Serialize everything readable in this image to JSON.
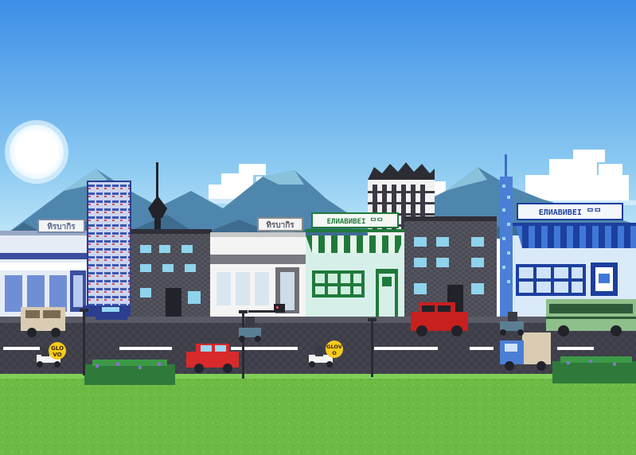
{
  "signs": {
    "sign_1": "ทิรบากิร",
    "sign_2": "ทิรบากิร",
    "sign_3": "ЕЛИАВИВЕІ ᄆᄆ",
    "sign_4": "ЕЛИАВИВЕІ ᄆᄆ"
  },
  "scooters": {
    "badge_1_line1": "GLO",
    "badge_1_line2": "VO",
    "badge_2_line1": "GLOV",
    "badge_2_line2": "O"
  },
  "colors": {
    "sky_top": "#3c8ee8",
    "sky_bottom": "#bfe6f8",
    "mountain": "#4f86ad",
    "road": "#3d3d48",
    "grass": "#6dba45",
    "awning_blue": "#1d3f9e",
    "awning_green": "#1f7a3a",
    "glovo_yellow": "#f6c91d",
    "red_car": "#d82a2a",
    "jeep_red": "#c81f1f",
    "bus_green": "#8fbf8a",
    "van_beige": "#d9ccb3"
  }
}
